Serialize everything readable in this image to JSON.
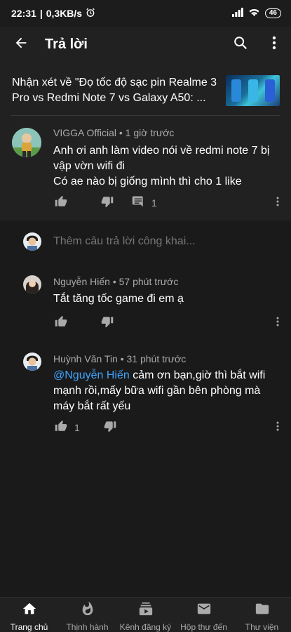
{
  "status_bar": {
    "time": "22:31",
    "network_speed": "0,3KB/s",
    "battery": "46"
  },
  "app_bar": {
    "title": "Trả lời"
  },
  "video": {
    "title": "Nhận xét về \"Đọ tốc độ sạc pin Realme 3 Pro vs Redmi Note 7 vs Galaxy A50: ..."
  },
  "parent_comment": {
    "author": "VIGGA Official",
    "time": "1 giờ trước",
    "meta": "VIGGA Official • 1 giờ trước",
    "line1": "Anh ơi anh làm video nói về redmi note 7 bị vập vờn wifi đi",
    "line2": "Có ae nào bị giống mình thì cho 1 like",
    "reply_count": "1"
  },
  "reply_input": {
    "placeholder": "Thêm câu trả lời công khai..."
  },
  "replies": [
    {
      "meta": "Nguyễn Hiến • 57 phút trước",
      "text": "Tắt tăng tốc game đi em ạ",
      "like_count": ""
    },
    {
      "meta": "Huỳnh Văn Tin • 31 phút trước",
      "mention": "@Nguyễn Hiến",
      "text": " cảm ơn bạn,giờ thì bắt wifi mạnh rồi,mấy bữa wifi gần bên phòng mà máy bắt rất yếu",
      "like_count": "1"
    }
  ],
  "bottom_nav": [
    {
      "label": "Trang chủ",
      "icon": "home-icon",
      "active": true
    },
    {
      "label": "Thịnh hành",
      "icon": "trending-icon"
    },
    {
      "label": "Kênh đăng ký",
      "icon": "subscriptions-icon"
    },
    {
      "label": "Hộp thư đến",
      "icon": "inbox-icon"
    },
    {
      "label": "Thư viện",
      "icon": "library-icon"
    }
  ],
  "colors": {
    "background": "#212121",
    "reply_background": "#1a1a1a",
    "mention": "#3ea6ff",
    "meta": "#aaaaaa"
  }
}
